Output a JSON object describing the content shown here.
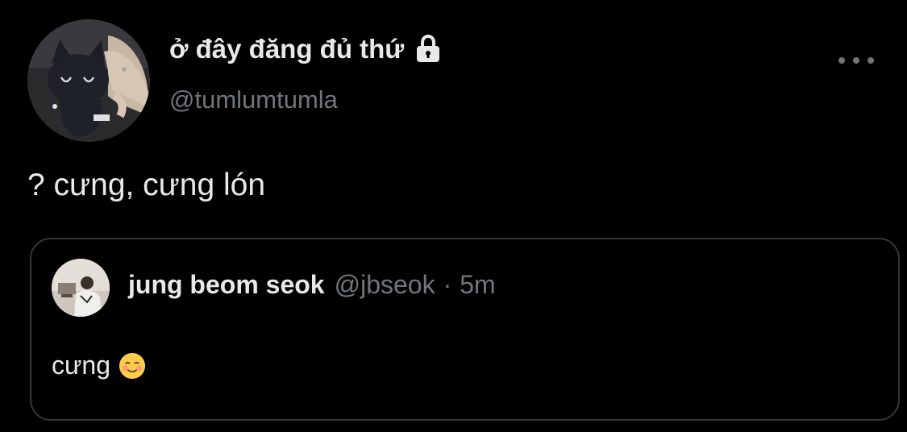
{
  "tweet": {
    "author": {
      "name": "ở đây đăng đủ thứ",
      "handle": "@tumlumtumla",
      "avatar_icon": "plush-cat-avatar",
      "locked_icon": "lock-icon"
    },
    "more_icon": "more-horizontal-icon",
    "text": "? cưng, cưng lón"
  },
  "quote": {
    "author": {
      "name": "jung beom seok",
      "handle": "@jbseok",
      "separator": "·",
      "time": "5m",
      "avatar_icon": "photo-avatar"
    },
    "text": "cưng",
    "emoji": "smiling-face-icon"
  },
  "colors": {
    "background": "#000000",
    "primary_text": "#e7e9ea",
    "secondary_text": "#71767b",
    "border": "#333639"
  }
}
